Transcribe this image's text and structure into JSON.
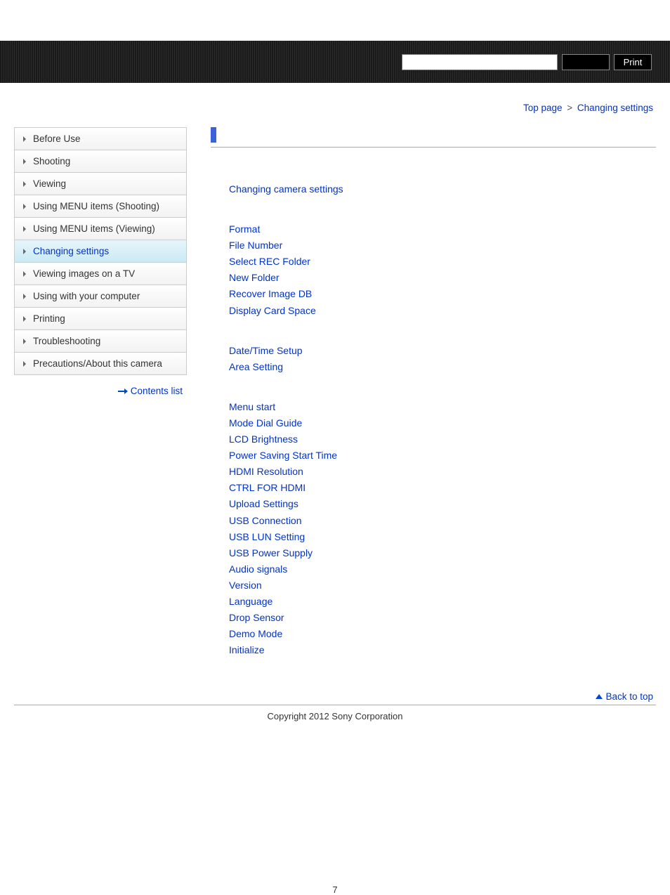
{
  "header": {
    "search_value": "",
    "search_button_label": "",
    "print_label": "Print"
  },
  "breadcrumb": {
    "top": "Top page",
    "sep": ">",
    "current": "Changing settings"
  },
  "sidebar": {
    "items": [
      {
        "label": "Before Use",
        "active": false
      },
      {
        "label": "Shooting",
        "active": false
      },
      {
        "label": "Viewing",
        "active": false
      },
      {
        "label": "Using MENU items (Shooting)",
        "active": false
      },
      {
        "label": "Using MENU items (Viewing)",
        "active": false
      },
      {
        "label": "Changing settings",
        "active": true
      },
      {
        "label": "Viewing images on a TV",
        "active": false
      },
      {
        "label": "Using with your computer",
        "active": false
      },
      {
        "label": "Printing",
        "active": false
      },
      {
        "label": "Troubleshooting",
        "active": false
      },
      {
        "label": "Precautions/About this camera",
        "active": false
      }
    ],
    "contents_list_label": "Contents list"
  },
  "main": {
    "title": "",
    "groups": [
      {
        "heading": "Changing camera settings",
        "links": []
      },
      {
        "heading": null,
        "links": [
          "Format",
          "File Number",
          "Select REC Folder",
          "New Folder",
          "Recover Image DB",
          "Display Card Space"
        ]
      },
      {
        "heading": null,
        "links": [
          "Date/Time Setup",
          "Area Setting"
        ]
      },
      {
        "heading": null,
        "links": [
          "Menu start",
          "Mode Dial Guide",
          "LCD Brightness",
          "Power Saving Start Time",
          "HDMI Resolution",
          "CTRL FOR HDMI",
          "Upload Settings",
          "USB Connection",
          "USB LUN Setting",
          "USB Power Supply",
          "Audio signals",
          "Version",
          "Language",
          "Drop Sensor",
          "Demo Mode",
          "Initialize"
        ]
      }
    ]
  },
  "back_to_top": "Back to top",
  "copyright": "Copyright 2012 Sony Corporation",
  "page_number": "7"
}
